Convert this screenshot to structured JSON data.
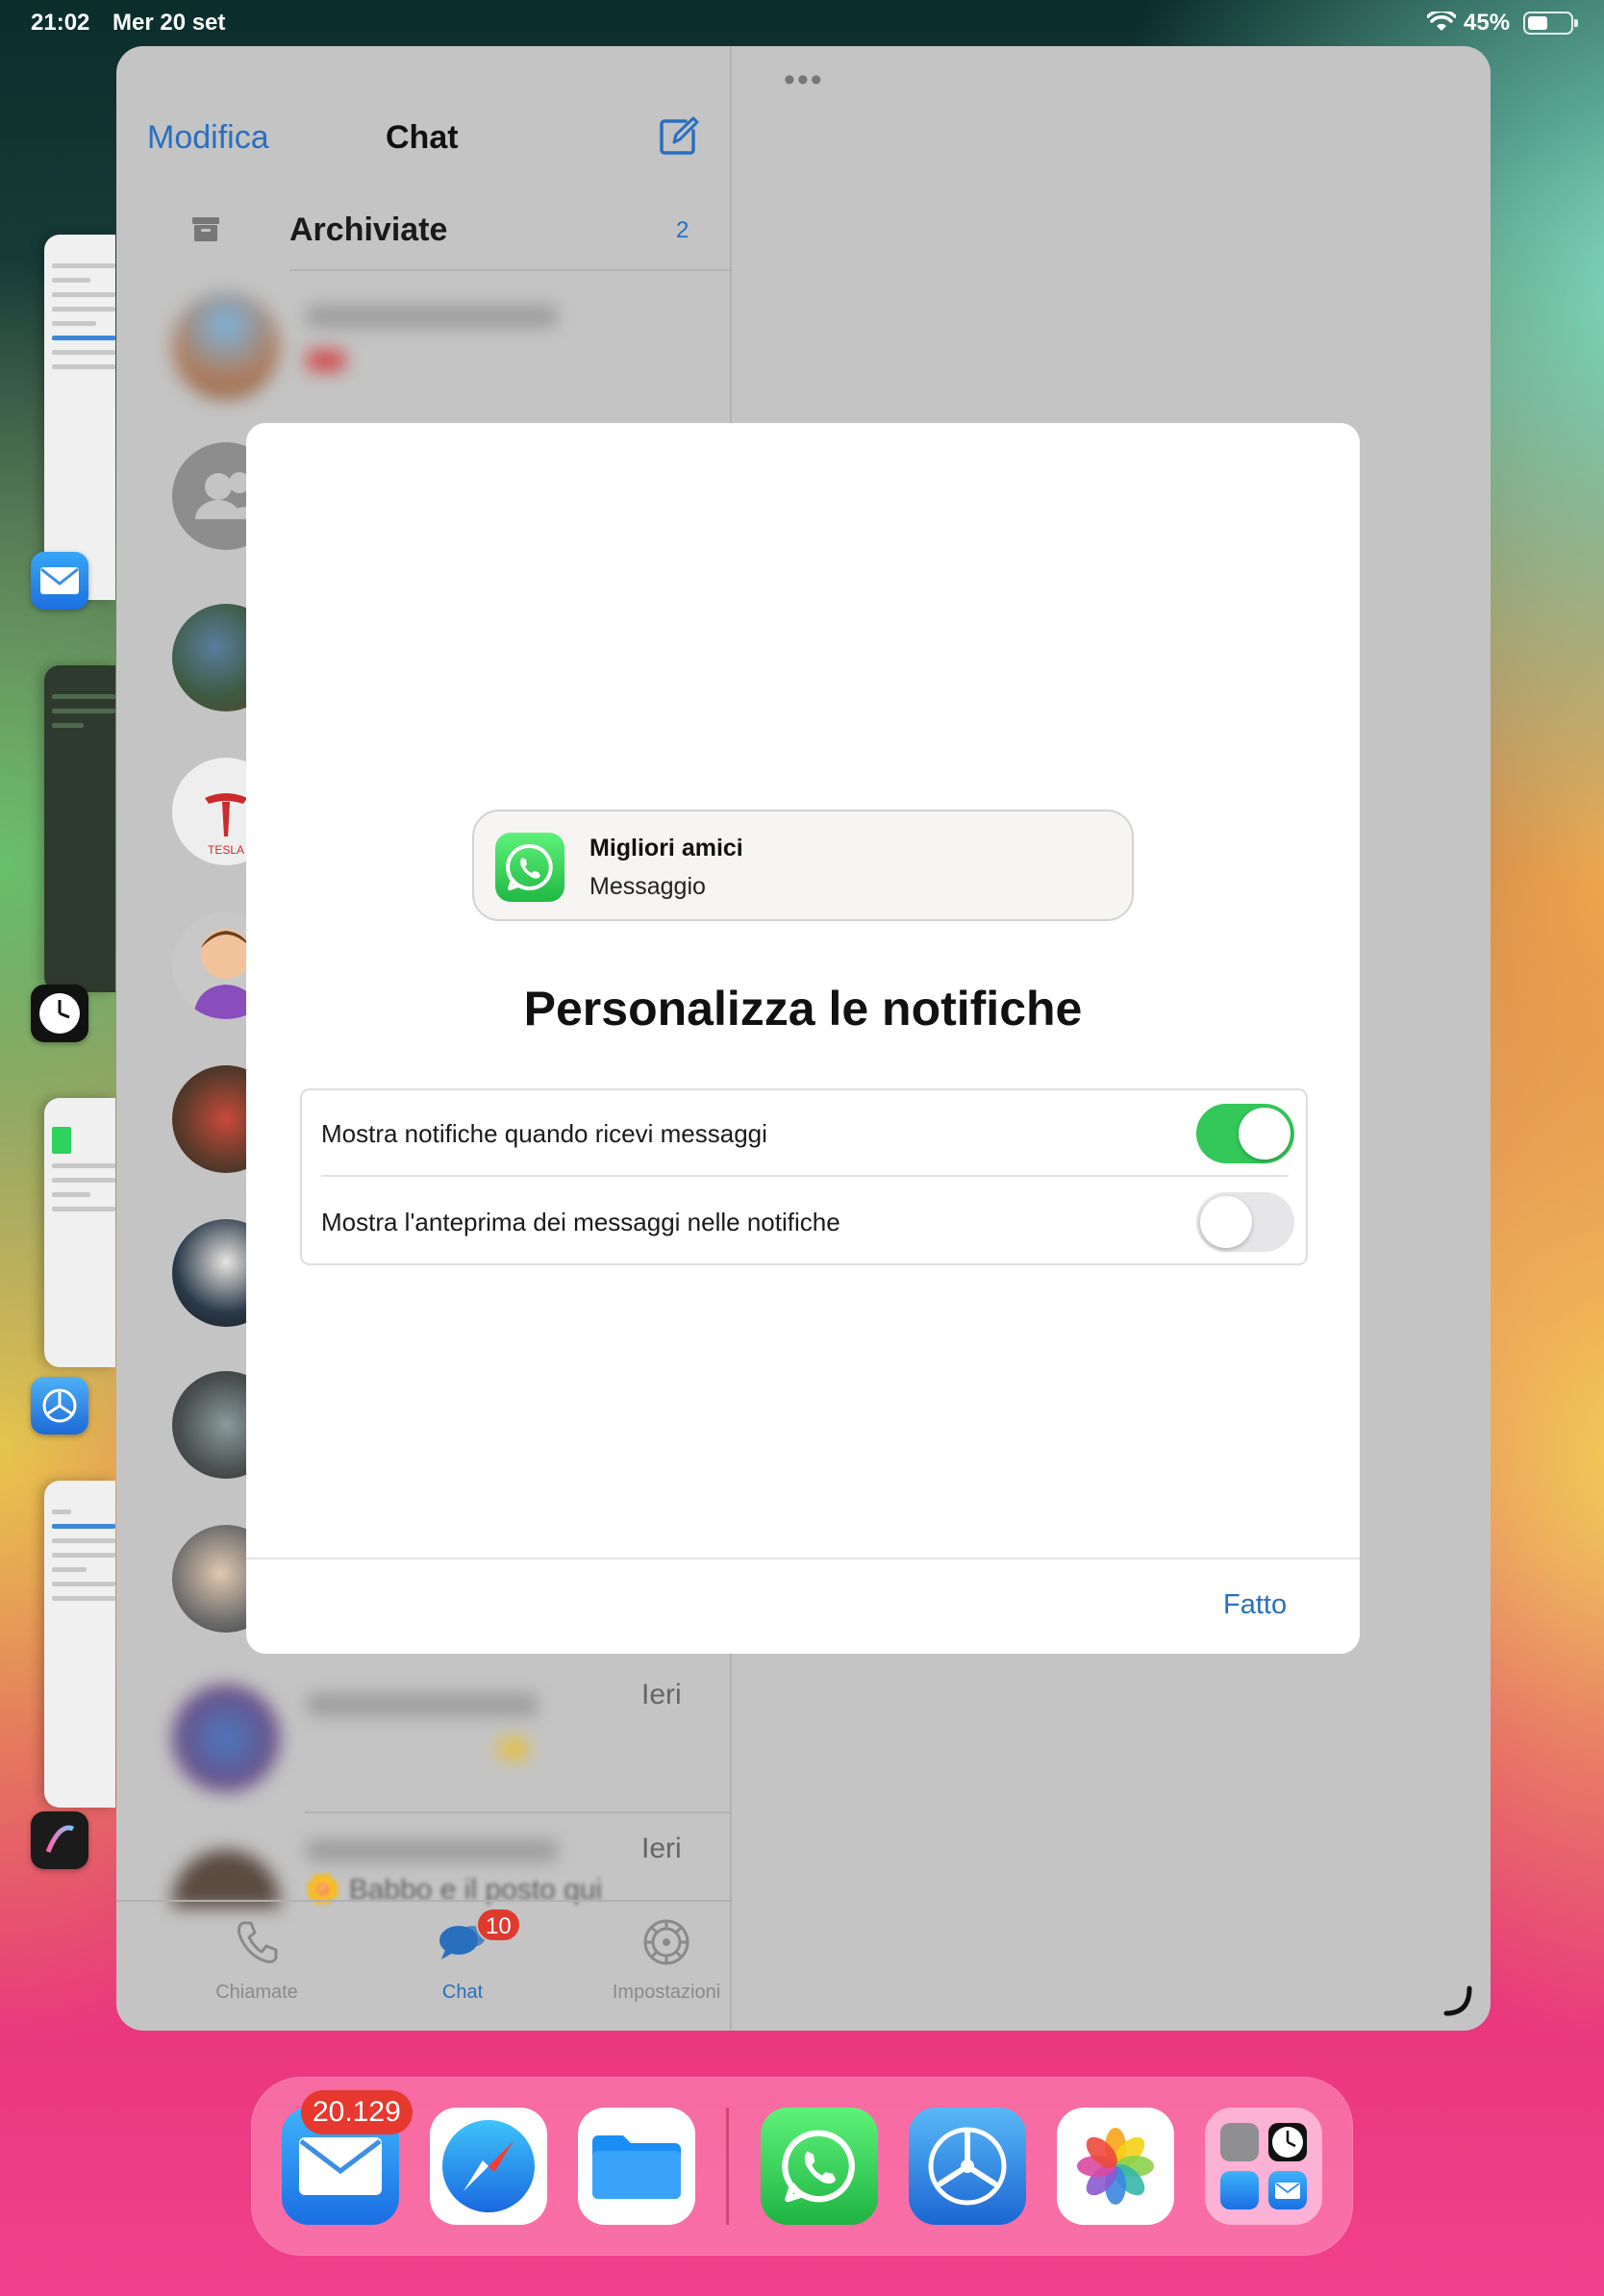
{
  "status_bar": {
    "time": "21:02",
    "date": "Mer 20 set",
    "battery_pct": "45%",
    "battery_level": 0.45
  },
  "sidebar": {
    "edit_label": "Modifica",
    "title": "Chat",
    "archived_label": "Archiviate",
    "archived_count": "2",
    "row_date_1": "Ieri",
    "row_date_2": "Ieri",
    "partial_preview": "🌼 Babbo e il posto qui"
  },
  "tabbar": {
    "tabs": [
      {
        "label": "Chiamate",
        "icon": "phone-icon"
      },
      {
        "label": "Chat",
        "icon": "chat-bubbles-icon",
        "badge": "10",
        "active": true
      },
      {
        "label": "Impostazioni",
        "icon": "gear-icon"
      }
    ]
  },
  "modal": {
    "notification_title": "Migliori amici",
    "notification_body": "Messaggio",
    "title": "Personalizza le notifiche",
    "settings": [
      {
        "label": "Mostra notifiche quando ricevi messaggi",
        "enabled": true
      },
      {
        "label": "Mostra l'anteprima dei messaggi nelle notifiche",
        "enabled": false
      }
    ],
    "done_label": "Fatto"
  },
  "dock": {
    "apps": [
      "mail-app",
      "safari-app",
      "files-app",
      "whatsapp-app",
      "testflight-app",
      "photos-app",
      "app-library-folder"
    ],
    "mail_badge": "20.129"
  },
  "colors": {
    "accent": "#2a6fbe",
    "toggle_on": "#34c759",
    "badge": "#e0392e",
    "whatsapp": "#25d366"
  }
}
